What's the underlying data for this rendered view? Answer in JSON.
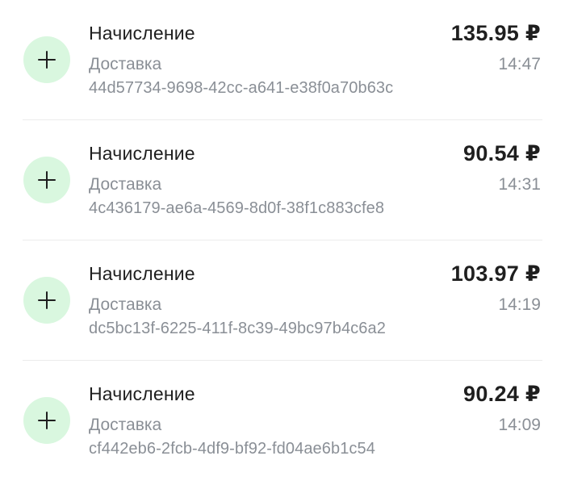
{
  "colors": {
    "icon_bg": "#d9f7df",
    "primary_text": "#1f1f1f",
    "secondary_text": "#8a8f96"
  },
  "icon": "plus-icon",
  "transactions": [
    {
      "title": "Начисление",
      "subtitle": "Доставка",
      "order_id": "44d57734-9698-42cc-a641-e38f0a70b63c",
      "amount": "135.95 ₽",
      "time": "14:47"
    },
    {
      "title": "Начисление",
      "subtitle": "Доставка",
      "order_id": "4c436179-ae6a-4569-8d0f-38f1c883cfe8",
      "amount": "90.54 ₽",
      "time": "14:31"
    },
    {
      "title": "Начисление",
      "subtitle": "Доставка",
      "order_id": "dc5bc13f-6225-411f-8c39-49bc97b4c6a2",
      "amount": "103.97 ₽",
      "time": "14:19"
    },
    {
      "title": "Начисление",
      "subtitle": "Доставка",
      "order_id": "cf442eb6-2fcb-4df9-bf92-fd04ae6b1c54",
      "amount": "90.24 ₽",
      "time": "14:09"
    }
  ]
}
